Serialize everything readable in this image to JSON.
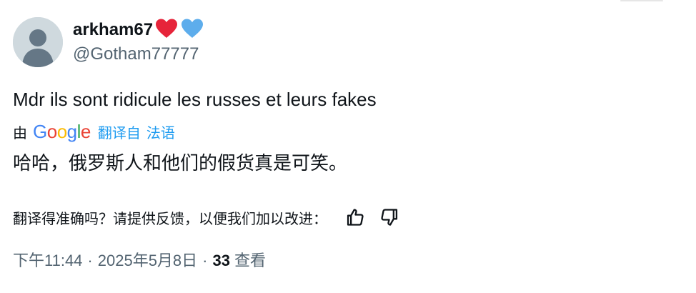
{
  "author": {
    "display_name": "arkham67",
    "handle": "@Gotham77777",
    "emoji_badges": [
      "red-heart",
      "blue-heart"
    ]
  },
  "tweet": {
    "text": "Mdr ils sont ridicule les russes et leurs fakes"
  },
  "translation": {
    "by_label": "由",
    "provider": "Google",
    "provider_letters": [
      {
        "char": "G",
        "color": "#4285F4"
      },
      {
        "char": "o",
        "color": "#EA4335"
      },
      {
        "char": "o",
        "color": "#FBBC05"
      },
      {
        "char": "g",
        "color": "#4285F4"
      },
      {
        "char": "l",
        "color": "#34A853"
      },
      {
        "char": "e",
        "color": "#EA4335"
      }
    ],
    "translated_from_label": "翻译自",
    "source_language": "法语",
    "translated_text": "哈哈，俄罗斯人和他们的假货真是可笑。",
    "feedback_prompt": "翻译得准确吗？请提供反馈，以便我们加以改进："
  },
  "meta": {
    "time": "下午11:44",
    "date": "2025年5月8日",
    "separator": "·",
    "views_count": "33",
    "views_label": "查看"
  },
  "colors": {
    "accent": "#1d9bf0",
    "secondary_text": "#536471",
    "primary_text": "#0f1419",
    "avatar_bg": "#cfd9de"
  }
}
